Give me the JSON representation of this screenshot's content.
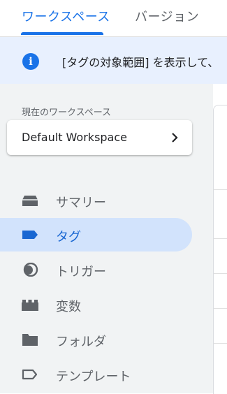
{
  "tabs": [
    {
      "label": "ワークスペース",
      "active": true
    },
    {
      "label": "バージョン",
      "active": false
    }
  ],
  "banner": {
    "icon": "info-icon",
    "text": "[タグの対象範囲] を表示して、"
  },
  "workspace": {
    "label": "現在のワークスペース",
    "name": "Default Workspace",
    "icon": "chevron-right-icon"
  },
  "nav": [
    {
      "label": "サマリー",
      "icon": "inbox-icon",
      "selected": false
    },
    {
      "label": "タグ",
      "icon": "tag-icon",
      "selected": true
    },
    {
      "label": "トリガー",
      "icon": "trigger-icon",
      "selected": false
    },
    {
      "label": "変数",
      "icon": "variable-brick-icon",
      "selected": false
    },
    {
      "label": "フォルダ",
      "icon": "folder-icon",
      "selected": false
    },
    {
      "label": "テンプレート",
      "icon": "tag-outline-icon",
      "selected": false
    }
  ],
  "colors": {
    "accent": "#1a73e8",
    "selected_bg": "#d2e3fc",
    "banner_bg": "#e8f0fe",
    "sidebar_bg": "#f1f3f4",
    "icon": "#5f6368"
  }
}
